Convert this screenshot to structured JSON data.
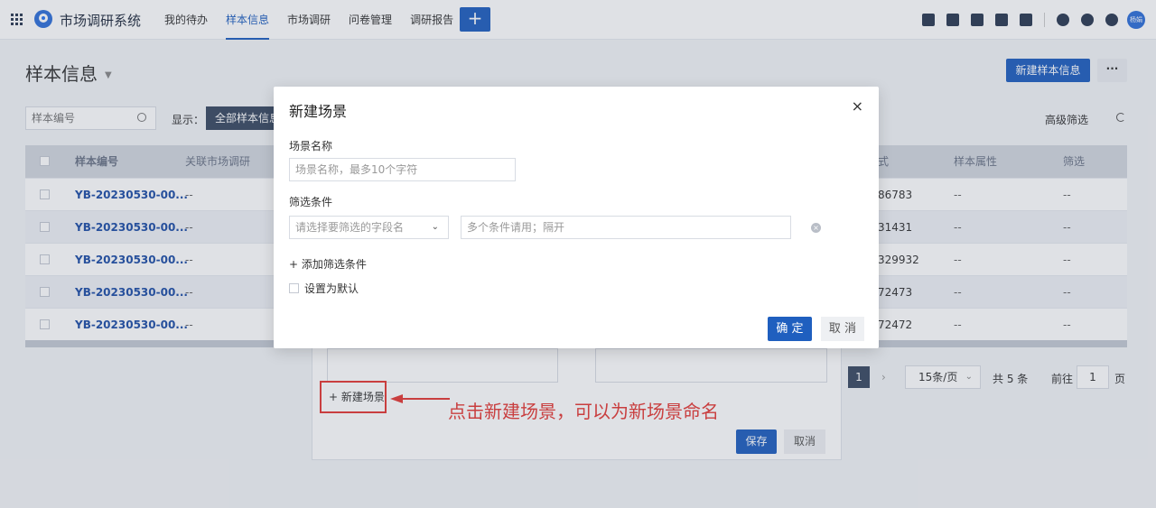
{
  "header": {
    "app_title": "市场调研系统",
    "nav": [
      "我的待办",
      "样本信息",
      "市场调研",
      "问卷管理",
      "调研报告"
    ],
    "plus_label": "+",
    "avatar_text": "杨娟"
  },
  "page": {
    "title": "样本信息",
    "new_sample_button": "新建样本信息",
    "more_button": "···",
    "search_placeholder": "样本编号",
    "show_label": "显示：",
    "show_value": "全部样本信息",
    "advanced_filter": "高级筛选"
  },
  "table": {
    "headers": [
      "样本编号",
      "关联市场调研",
      "式",
      "样本属性",
      "筛选"
    ],
    "rows": [
      {
        "id": "YB-20230530-00...",
        "rel": "--",
        "right": "86783",
        "attr": "--",
        "filter": "--"
      },
      {
        "id": "YB-20230530-00...",
        "rel": "--",
        "right": "31431",
        "attr": "--",
        "filter": "--"
      },
      {
        "id": "YB-20230530-00...",
        "rel": "--",
        "right": "329932",
        "attr": "--",
        "filter": "--"
      },
      {
        "id": "YB-20230530-00...",
        "rel": "--",
        "right": "72473",
        "attr": "--",
        "filter": "--"
      },
      {
        "id": "YB-20230530-00...",
        "rel": "--",
        "right": "72472",
        "attr": "--",
        "filter": "--"
      }
    ]
  },
  "pagination": {
    "current": "1",
    "next": "›",
    "page_size": "15条/页",
    "total": "共 5 条",
    "goto_label": "前往",
    "goto_value": "1",
    "page_suffix": "页"
  },
  "under_panel": {
    "new_scene": "+ 新建场景",
    "save": "保存",
    "cancel": "取消"
  },
  "annotation": {
    "text": "点击新建场景，可以为新场景命名",
    "color": "#e53935"
  },
  "modal": {
    "title": "新建场景",
    "close": "×",
    "scene_name_label": "场景名称",
    "scene_name_placeholder": "场景名称，最多10个字符",
    "filter_label": "筛选条件",
    "field_placeholder": "请选择要筛选的字段名",
    "cond_placeholder": "多个条件请用；隔开",
    "add_condition": "+ 添加筛选条件",
    "set_default": "设置为默认",
    "ok": "确 定",
    "cancel": "取 消"
  },
  "colors": {
    "primary": "#1f5fbf",
    "dark": "#3a4a62",
    "annotation": "#e53935"
  }
}
